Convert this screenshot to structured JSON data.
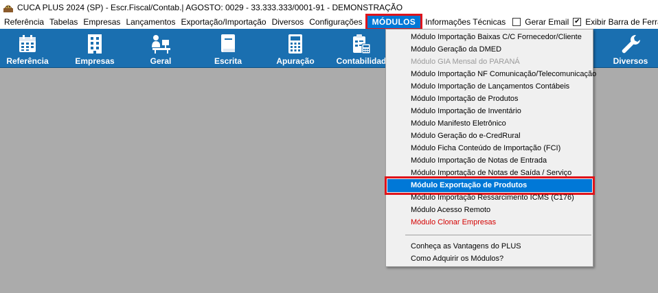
{
  "window": {
    "title": "CUCA PLUS 2024 (SP) - Escr.Fiscal/Contab.| AGOSTO: 0029 - 33.333.333/0001-91 - DEMONSTRAÇÃO",
    "icon": "cuca-app-icon"
  },
  "menubar": {
    "items": [
      "Referência",
      "Tabelas",
      "Empresas",
      "Lançamentos",
      "Exportação/Importação",
      "Diversos",
      "Configurações",
      "MÓDULOS",
      "Informações Técnicas"
    ],
    "active": "MÓDULOS",
    "checks": [
      {
        "label": "Gerar Email",
        "checked": false
      },
      {
        "label": "Exibir Barra de Ferra",
        "checked": true
      }
    ]
  },
  "toolbar": {
    "buttons": [
      {
        "label": "Referência",
        "icon": "calendar-icon"
      },
      {
        "label": "Empresas",
        "icon": "building-icon"
      },
      {
        "label": "Geral",
        "icon": "person-desk-icon"
      },
      {
        "label": "Escrita",
        "icon": "book-icon"
      },
      {
        "label": "Apuração",
        "icon": "calculator-icon"
      },
      {
        "label": "Contabilidad",
        "icon": "accounting-icon"
      },
      {
        "label": "Diversos",
        "icon": "wrench-icon"
      }
    ]
  },
  "modules_menu": {
    "items": [
      "Módulo Importação Baixas C/C Fornecedor/Cliente",
      "Módulo Geração da DMED",
      "Módulo GIA Mensal do PARANÁ",
      "Módulo Importação NF Comunicação/Telecomunicação",
      "Módulo Importação de Lançamentos Contábeis",
      "Módulo Importação de Produtos",
      "Módulo Importação de Inventário",
      "Módulo Manifesto Eletrônico",
      "Módulo Geração do e-CredRural",
      "Módulo Ficha Conteúdo de Importação (FCI)",
      "Módulo Importação de Notas de Entrada",
      "Módulo Importação de Notas de Saída / Serviço",
      "Módulo Exportação de Produtos",
      "Módulo Importação Ressarcimento ICMS (C176)",
      "Módulo Acesso Remoto",
      "Módulo Clonar Empresas",
      "Conheça as Vantagens do PLUS",
      "Como Adquirir os Módulos?"
    ],
    "highlighted": "Módulo Exportação de Produtos",
    "disabled_item": "Módulo GIA Mensal do PARANÁ",
    "red_item": "Módulo Clonar Empresas"
  },
  "colors": {
    "toolbar_bg": "#1a6fb0",
    "highlight": "#0078d7",
    "annotation_box": "#e0141b",
    "workspace_bg": "#ababab"
  }
}
